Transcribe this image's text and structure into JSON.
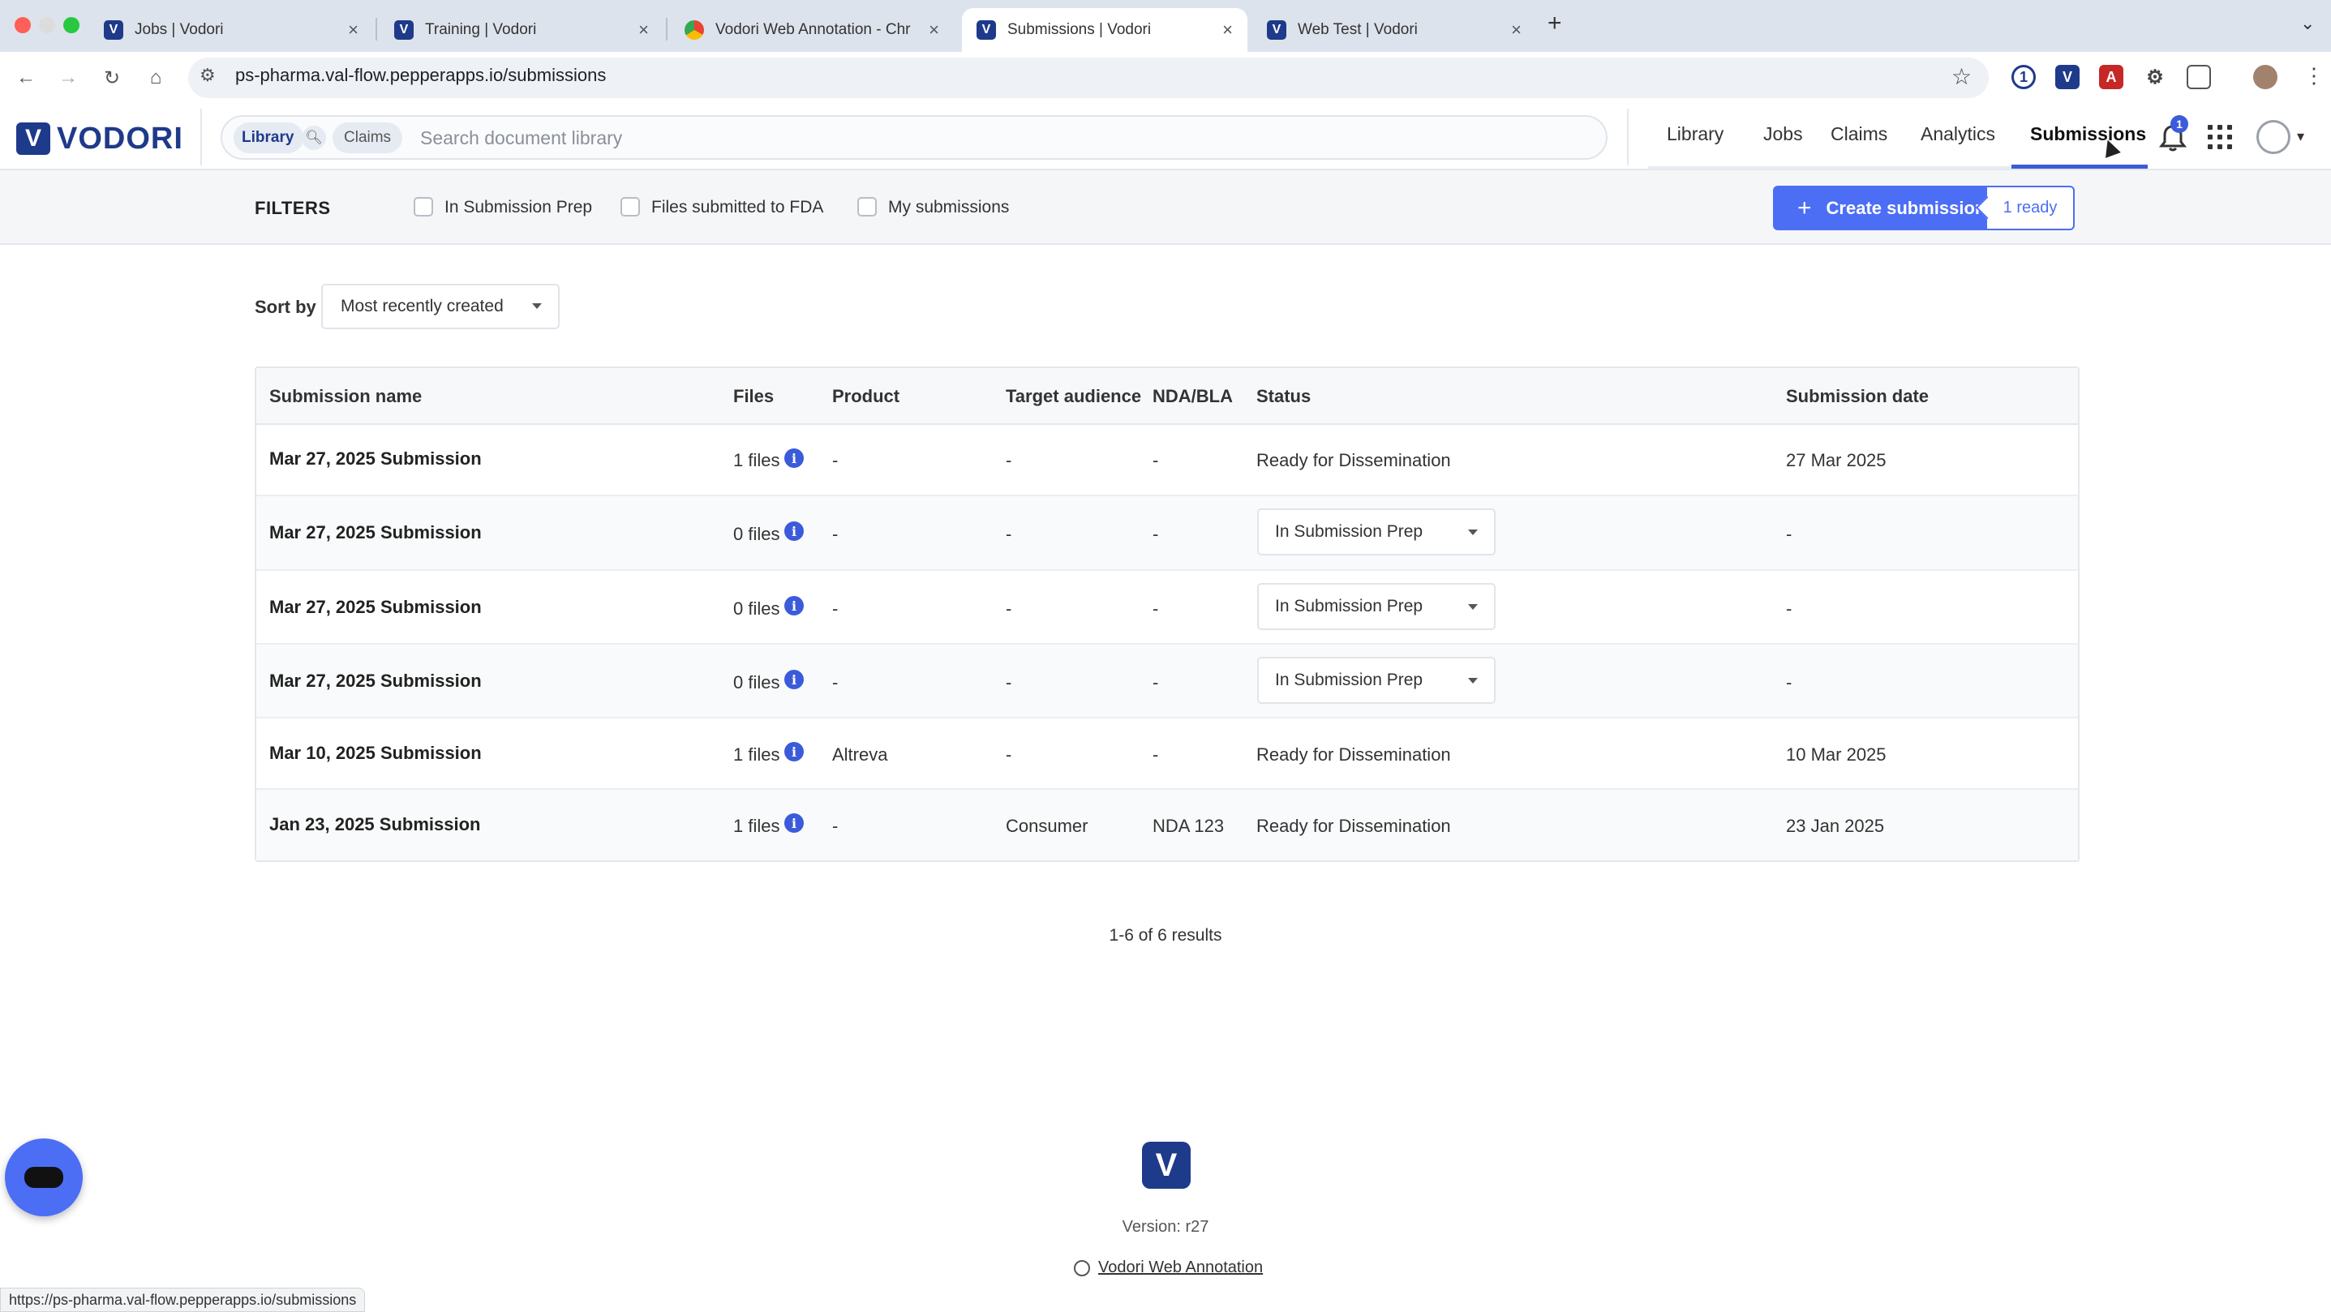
{
  "browser": {
    "tabs": [
      {
        "title": "Jobs | Vodori",
        "favicon": "vodori-icon"
      },
      {
        "title": "Training | Vodori",
        "favicon": "vodori-icon"
      },
      {
        "title": "Vodori Web Annotation - Chr",
        "favicon": "chrome-icon"
      },
      {
        "title": "Submissions | Vodori",
        "favicon": "vodori-icon",
        "active": true
      },
      {
        "title": "Web Test | Vodori",
        "favicon": "vodori-icon"
      }
    ],
    "new_tab": "+",
    "url": "ps-pharma.val-flow.pepperapps.io/submissions",
    "status_url": "https://ps-pharma.val-flow.pepperapps.io/submissions"
  },
  "app": {
    "logo_text": "VODORI",
    "search": {
      "library_label": "Library",
      "claims_label": "Claims",
      "placeholder": "Search document library"
    },
    "nav": [
      "Library",
      "Jobs",
      "Claims",
      "Analytics",
      "Submissions"
    ],
    "active_nav": "Submissions",
    "notification_count": "1",
    "accent_color": "#4c6ef5",
    "brand_color": "#1e3a8a"
  },
  "filters": {
    "label": "FILTERS",
    "options": [
      "In Submission Prep",
      "Files submitted to FDA",
      "My submissions"
    ],
    "create_button": "Create submission",
    "ready_badge": "1 ready"
  },
  "sort": {
    "label": "Sort by",
    "value": "Most recently created"
  },
  "table": {
    "headers": [
      "Submission name",
      "Files",
      "Product",
      "Target audience",
      "NDA/BLA",
      "Status",
      "Submission date"
    ],
    "rows": [
      {
        "name": "Mar 27, 2025 Submission",
        "files": "1 files",
        "product": "-",
        "audience": "-",
        "nda": "-",
        "status": "Ready for Dissemination",
        "status_dropdown": false,
        "date": "27 Mar 2025"
      },
      {
        "name": "Mar 27, 2025 Submission",
        "files": "0 files",
        "product": "-",
        "audience": "-",
        "nda": "-",
        "status": "In Submission Prep",
        "status_dropdown": true,
        "date": "-"
      },
      {
        "name": "Mar 27, 2025 Submission",
        "files": "0 files",
        "product": "-",
        "audience": "-",
        "nda": "-",
        "status": "In Submission Prep",
        "status_dropdown": true,
        "date": "-"
      },
      {
        "name": "Mar 27, 2025 Submission",
        "files": "0 files",
        "product": "-",
        "audience": "-",
        "nda": "-",
        "status": "In Submission Prep",
        "status_dropdown": true,
        "date": "-"
      },
      {
        "name": "Mar 10, 2025 Submission",
        "files": "1 files",
        "product": "Altreva",
        "audience": "-",
        "nda": "-",
        "status": "Ready for Dissemination",
        "status_dropdown": false,
        "date": "10 Mar 2025"
      },
      {
        "name": "Jan 23, 2025 Submission",
        "files": "1 files",
        "product": "-",
        "audience": "Consumer",
        "nda": "NDA 123",
        "status": "Ready for Dissemination",
        "status_dropdown": false,
        "date": "23 Jan 2025"
      }
    ],
    "results_text": "1-6 of 6 results"
  },
  "footer": {
    "version": "Version: r27",
    "link": "Vodori Web Annotation"
  }
}
